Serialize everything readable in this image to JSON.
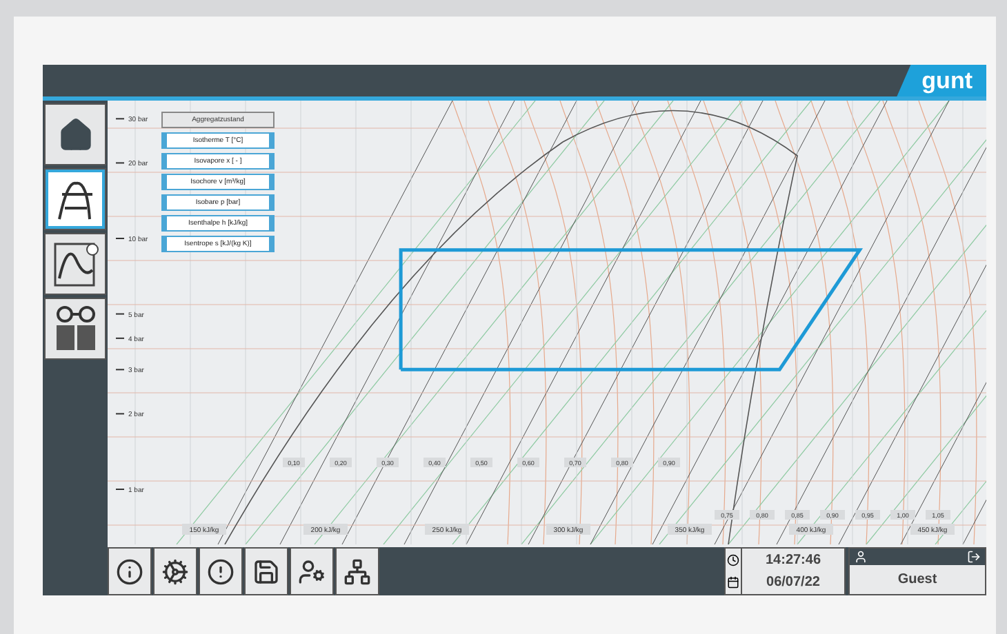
{
  "header": {
    "logo": "gunt"
  },
  "sidebar": {
    "items": [
      {
        "kind": "home",
        "selected": false
      },
      {
        "kind": "diagram",
        "selected": true
      },
      {
        "kind": "trend",
        "selected": false
      },
      {
        "kind": "manual",
        "selected": false
      }
    ]
  },
  "legend": {
    "title": "Aggregatzustand",
    "items": [
      {
        "label": "Isotherme T [°C]",
        "on": true
      },
      {
        "label": "Isovapore x [ - ]",
        "on": true
      },
      {
        "label": "Isochore v [m³/kg]",
        "on": true
      },
      {
        "label": "Isobare p [bar]",
        "on": true
      },
      {
        "label": "Isenthalpe h [kJ/kg]",
        "on": true
      },
      {
        "label": "Isentrope s [kJ/(kg K)]",
        "on": true
      }
    ]
  },
  "diagram": {
    "enthalpy_labels": [
      "150 kJ/kg",
      "200 kJ/kg",
      "250 kJ/kg",
      "300 kJ/kg",
      "350 kJ/kg",
      "400 kJ/kg",
      "450 kJ/kg"
    ],
    "pressure_labels": [
      "30 bar",
      "20 bar",
      "10 bar",
      "5 bar",
      "4 bar",
      "3 bar",
      "2 bar",
      "1 bar"
    ],
    "quality_labels": [
      "0,10",
      "0,20",
      "0,30",
      "0,40",
      "0,50",
      "0,60",
      "0,70",
      "0,80",
      "0,90"
    ],
    "entropy_labels": [
      "0,75",
      "0,80",
      "0,85",
      "0,90",
      "0,95",
      "1,00",
      "1,05"
    ]
  },
  "toolbar": {
    "items": [
      {
        "kind": "info"
      },
      {
        "kind": "settings"
      },
      {
        "kind": "alert"
      },
      {
        "kind": "save"
      },
      {
        "kind": "user-settings"
      },
      {
        "kind": "network"
      }
    ]
  },
  "status": {
    "time": "14:27:46",
    "date": "06/07/22",
    "user": "Guest"
  }
}
